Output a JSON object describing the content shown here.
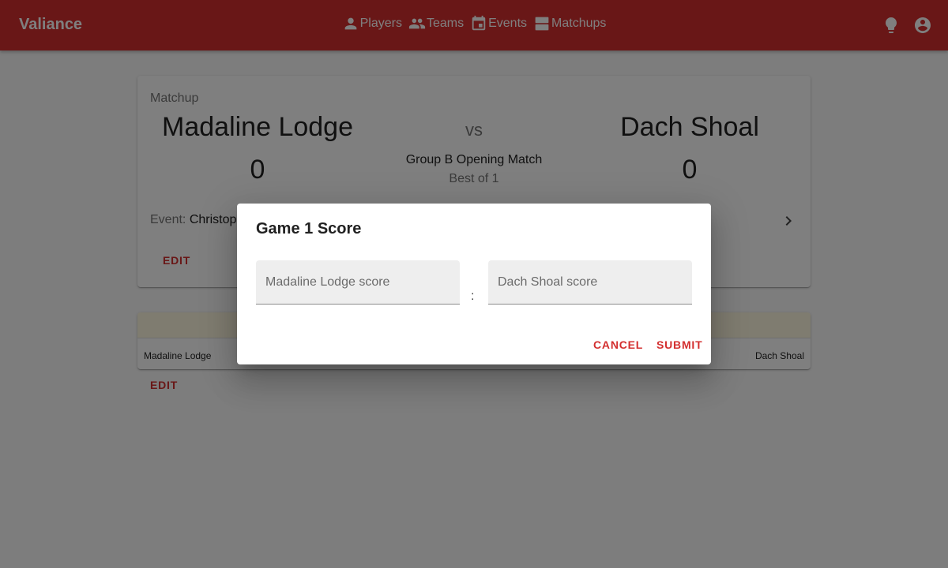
{
  "app": {
    "brand": "Valiance"
  },
  "nav": [
    {
      "label": "Players",
      "icon": "person-icon"
    },
    {
      "label": "Teams",
      "icon": "people-icon"
    },
    {
      "label": "Events",
      "icon": "calendar-icon"
    },
    {
      "label": "Matchups",
      "icon": "matchups-icon"
    }
  ],
  "appbar_icons": [
    "lightbulb-icon",
    "account-circle-icon"
  ],
  "colors": {
    "primary": "#d32f2f",
    "table_header": "#fff8e1",
    "scrim": "rgba(0,0,0,0.5)"
  },
  "matchup": {
    "overline": "Matchup",
    "team_a": "Madaline Lodge",
    "team_b": "Dach Shoal",
    "vs": "vs",
    "score_a": "0",
    "score_b": "0",
    "match_name": "Group B Opening Match",
    "format": "Best of 1",
    "event_label": "Event:",
    "event_value": "Christop",
    "edit_label": "EDIT"
  },
  "games": {
    "team_a": "Madaline Lodge",
    "team_b": "Dach Shoal",
    "edit_label": "EDIT"
  },
  "dialog": {
    "title": "Game 1 Score",
    "field_a_label": "Madaline Lodge score",
    "field_b_label": "Dach Shoal score",
    "field_a_value": "",
    "field_b_value": "",
    "separator": ":",
    "cancel_label": "CANCEL",
    "submit_label": "SUBMIT"
  }
}
